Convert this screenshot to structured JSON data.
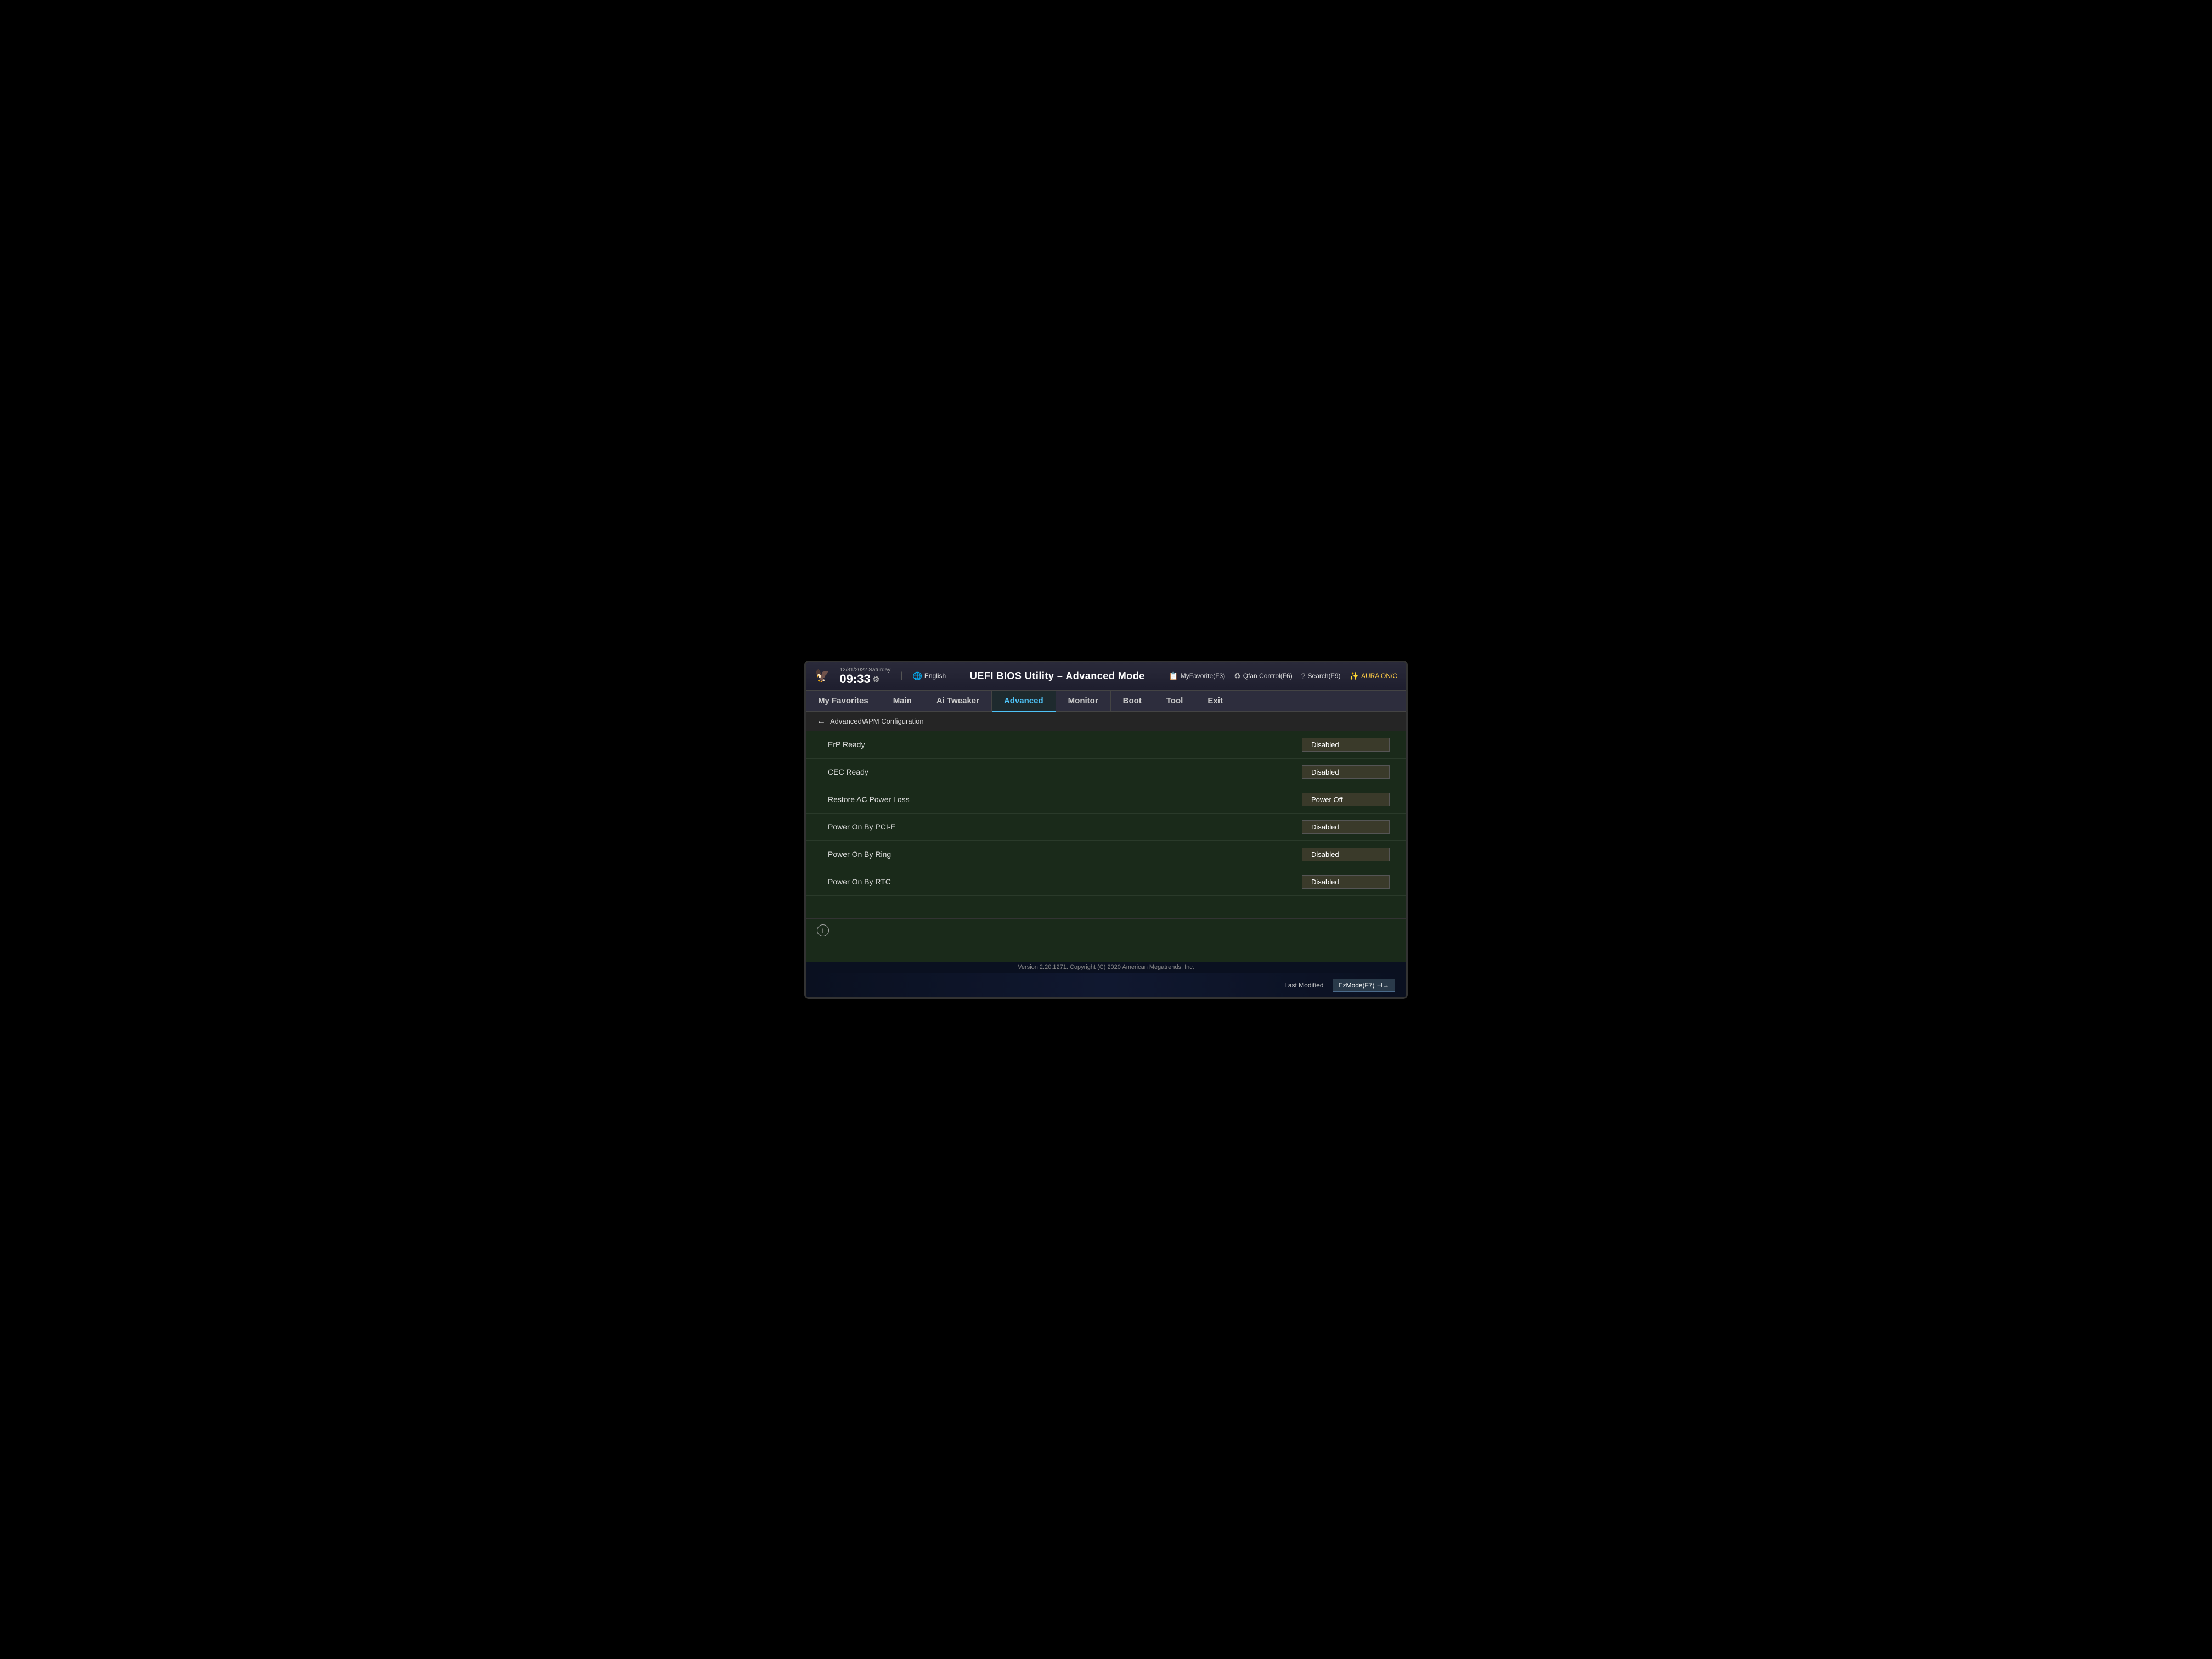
{
  "header": {
    "logo_symbol": "🦅",
    "title": "UEFI BIOS Utility – Advanced Mode",
    "date": "12/31/2022",
    "day": "Saturday",
    "time": "09:33",
    "gear_symbol": "⚙",
    "lang_icon": "🌐",
    "lang_label": "English",
    "myfav_icon": "📋",
    "myfav_label": "MyFavorite(F3)",
    "qfan_icon": "♻",
    "qfan_label": "Qfan Control(F6)",
    "search_icon": "?",
    "search_label": "Search(F9)",
    "aura_label": "AURA ON/C"
  },
  "nav": {
    "items": [
      {
        "id": "my-favorites",
        "label": "My Favorites",
        "active": false
      },
      {
        "id": "main",
        "label": "Main",
        "active": false
      },
      {
        "id": "ai-tweaker",
        "label": "Ai Tweaker",
        "active": false
      },
      {
        "id": "advanced",
        "label": "Advanced",
        "active": true
      },
      {
        "id": "monitor",
        "label": "Monitor",
        "active": false
      },
      {
        "id": "boot",
        "label": "Boot",
        "active": false
      },
      {
        "id": "tool",
        "label": "Tool",
        "active": false
      },
      {
        "id": "exit",
        "label": "Exit",
        "active": false
      }
    ]
  },
  "breadcrumb": {
    "back_arrow": "←",
    "path": "Advanced\\APM Configuration"
  },
  "settings": {
    "rows": [
      {
        "id": "erp-ready",
        "label": "ErP Ready",
        "value": "Disabled"
      },
      {
        "id": "cec-ready",
        "label": "CEC Ready",
        "value": "Disabled"
      },
      {
        "id": "restore-ac",
        "label": "Restore AC Power Loss",
        "value": "Power Off"
      },
      {
        "id": "power-pcie",
        "label": "Power On By PCI-E",
        "value": "Disabled"
      },
      {
        "id": "power-ring",
        "label": "Power On By Ring",
        "value": "Disabled"
      },
      {
        "id": "power-rtc",
        "label": "Power On By RTC",
        "value": "Disabled"
      }
    ]
  },
  "bottom": {
    "version_text": "Version 2.20.1271. Copyright (C) 2020 American Megatrends, Inc.",
    "last_modified_label": "Last Modified",
    "ez_mode_label": "EzMode(F7)",
    "ez_mode_icon": "⊣→"
  },
  "info_icon": "i"
}
